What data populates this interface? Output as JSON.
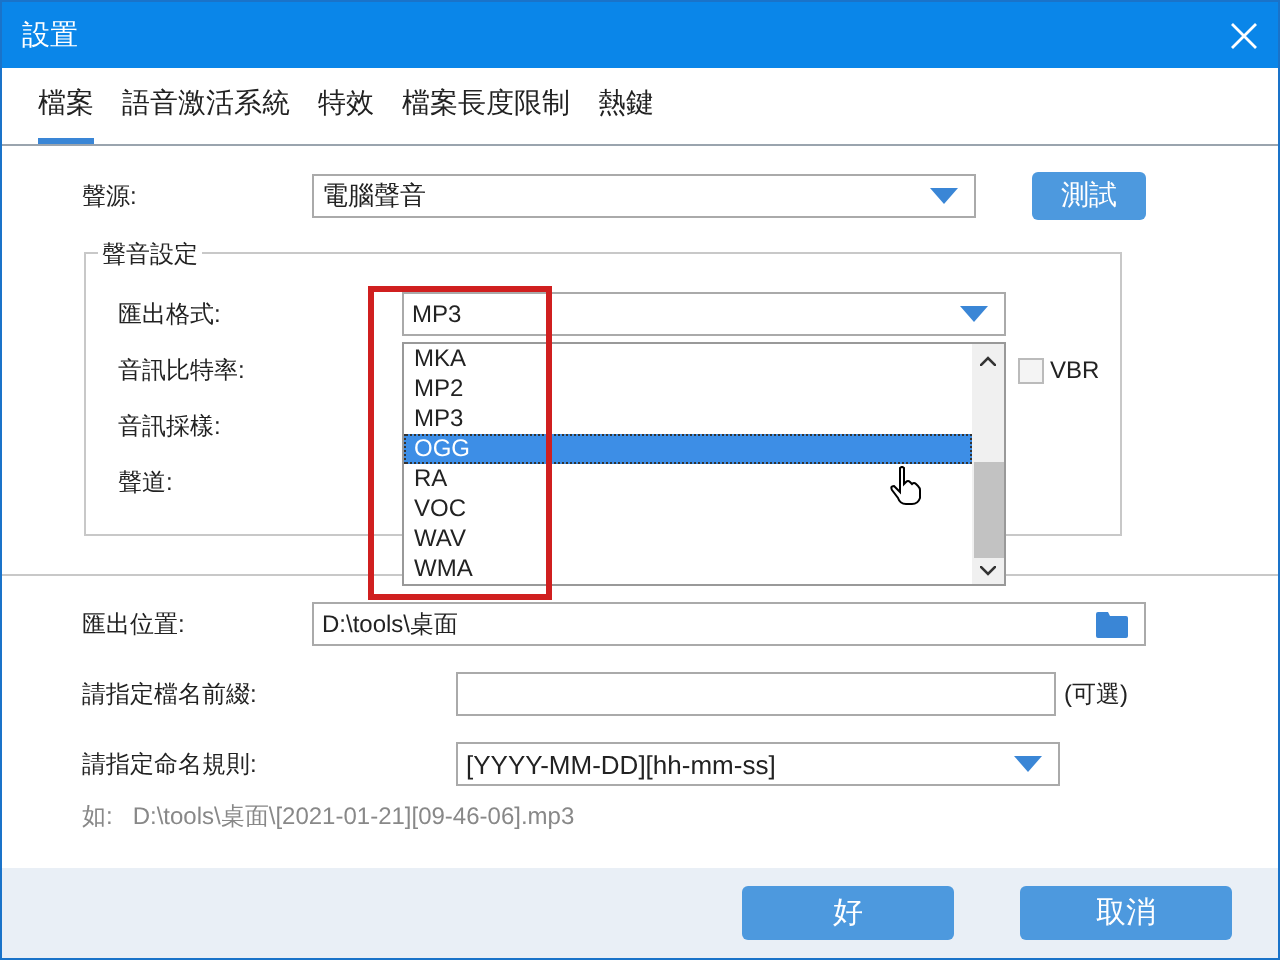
{
  "window": {
    "title": "設置"
  },
  "tabs": [
    {
      "label": "檔案",
      "selected": true
    },
    {
      "label": "語音激活系統",
      "selected": false
    },
    {
      "label": "特效",
      "selected": false
    },
    {
      "label": "檔案長度限制",
      "selected": false
    },
    {
      "label": "熱鍵",
      "selected": false
    }
  ],
  "source": {
    "label": "聲源:",
    "value": "電腦聲音",
    "button": "測試"
  },
  "sound_settings": {
    "title": "聲音設定",
    "format": {
      "label": "匯出格式:",
      "value": "MP3"
    },
    "labels": [
      "音訊比特率:",
      "音訊採樣:",
      "聲道:"
    ],
    "vbr": {
      "label": "VBR",
      "checked": false
    }
  },
  "format_dropdown": {
    "items": [
      {
        "label": "MKA",
        "selected": false
      },
      {
        "label": "MP2",
        "selected": false
      },
      {
        "label": "MP3",
        "selected": false
      },
      {
        "label": "OGG",
        "selected": true
      },
      {
        "label": "RA",
        "selected": false
      },
      {
        "label": "VOC",
        "selected": false
      },
      {
        "label": "WAV",
        "selected": false
      },
      {
        "label": "WMA",
        "selected": false
      }
    ]
  },
  "output": {
    "location": {
      "label": "匯出位置:",
      "value": "D:\\tools\\桌面"
    },
    "prefix": {
      "label": "請指定檔名前綴:",
      "note": "(可選)"
    },
    "naming": {
      "label": "請指定命名規則:",
      "value": "[YYYY-MM-DD][hh-mm-ss]"
    },
    "example": {
      "label": "如:",
      "value": "D:\\tools\\桌面\\[2021-01-21][09-46-06].mp3"
    }
  },
  "buttons": [
    {
      "label": "好"
    },
    {
      "label": "取消"
    }
  ]
}
